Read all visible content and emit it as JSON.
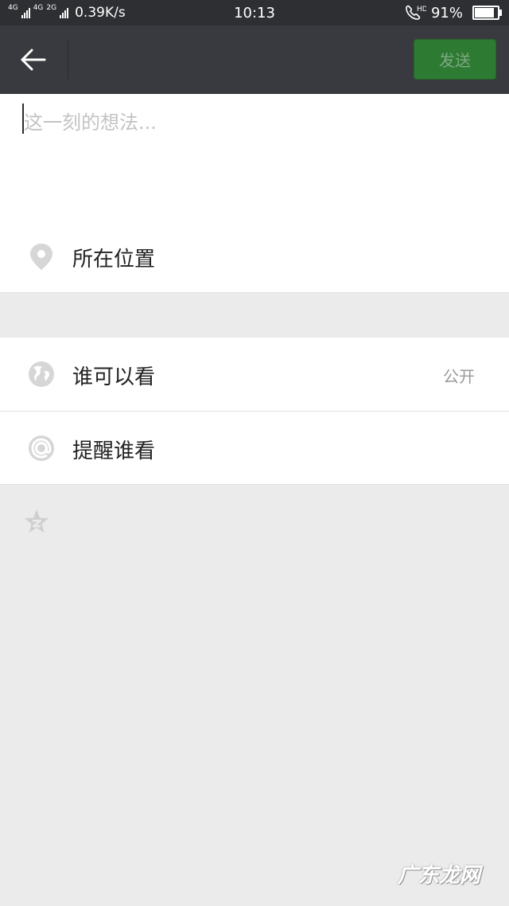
{
  "status_bar": {
    "net_tag_1": "4G",
    "net_tag_2": "4G",
    "net_tag_3": "2G",
    "speed": "0.39K/s",
    "time": "10:13",
    "hd_label": "HD",
    "battery": "91%",
    "battery_level": 0.91
  },
  "top_bar": {
    "back_icon": "arrow-left-icon",
    "send_label": "发送"
  },
  "compose": {
    "placeholder": "这一刻的想法..."
  },
  "location": {
    "icon": "location-pin-icon",
    "label": "所在位置"
  },
  "visibility": {
    "icon": "globe-icon",
    "label": "谁可以看",
    "value": "公开"
  },
  "mention": {
    "icon": "at-icon",
    "label": "提醒谁看"
  },
  "extra": {
    "icon": "star-icon"
  },
  "watermark": "广东龙网",
  "colors": {
    "status_bar": "#2e2f33",
    "top_bar": "#393a3f",
    "send_button": "#2d7a33",
    "background": "#ebebeb"
  }
}
